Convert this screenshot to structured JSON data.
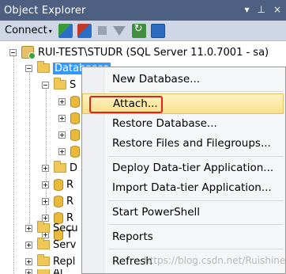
{
  "titlebar": {
    "title": "Object Explorer",
    "pin_glyph": "▾",
    "pushpin_glyph": "⊥",
    "close_glyph": "×"
  },
  "toolbar": {
    "connect_label": "Connect",
    "connect_arrow": "▾"
  },
  "tree": {
    "server_label": "RUI-TEST\\STUDR (SQL Server 11.0.7001 - sa)",
    "databases_label": "Databases",
    "child_stubs": [
      "S",
      "",
      "",
      "",
      "",
      "D",
      "R",
      "R",
      "R",
      "T"
    ],
    "security_label": "Secu",
    "server_objects_label": "Serv",
    "replication_label": "Repl",
    "always_on_label": "Al"
  },
  "context_menu": {
    "items": [
      {
        "label": "New Database..."
      },
      {
        "label": "Attach..."
      },
      {
        "label": "Restore Database..."
      },
      {
        "label": "Restore Files and Filegroups..."
      },
      {
        "label": "Deploy Data-tier Application..."
      },
      {
        "label": "Import Data-tier Application..."
      },
      {
        "label": "Start PowerShell"
      },
      {
        "label": "Reports"
      },
      {
        "label": "Refresh"
      }
    ],
    "highlighted_item": "Attach..."
  },
  "watermark": "https://blog.csdn.net/Ruishine",
  "colors": {
    "titlebar_bg": "#4d6082",
    "toolbar_bg": "#cfd6e5",
    "selection": "#3399ff",
    "menu_highlight": "#f8df8a",
    "annotation_red": "#e3211b"
  }
}
